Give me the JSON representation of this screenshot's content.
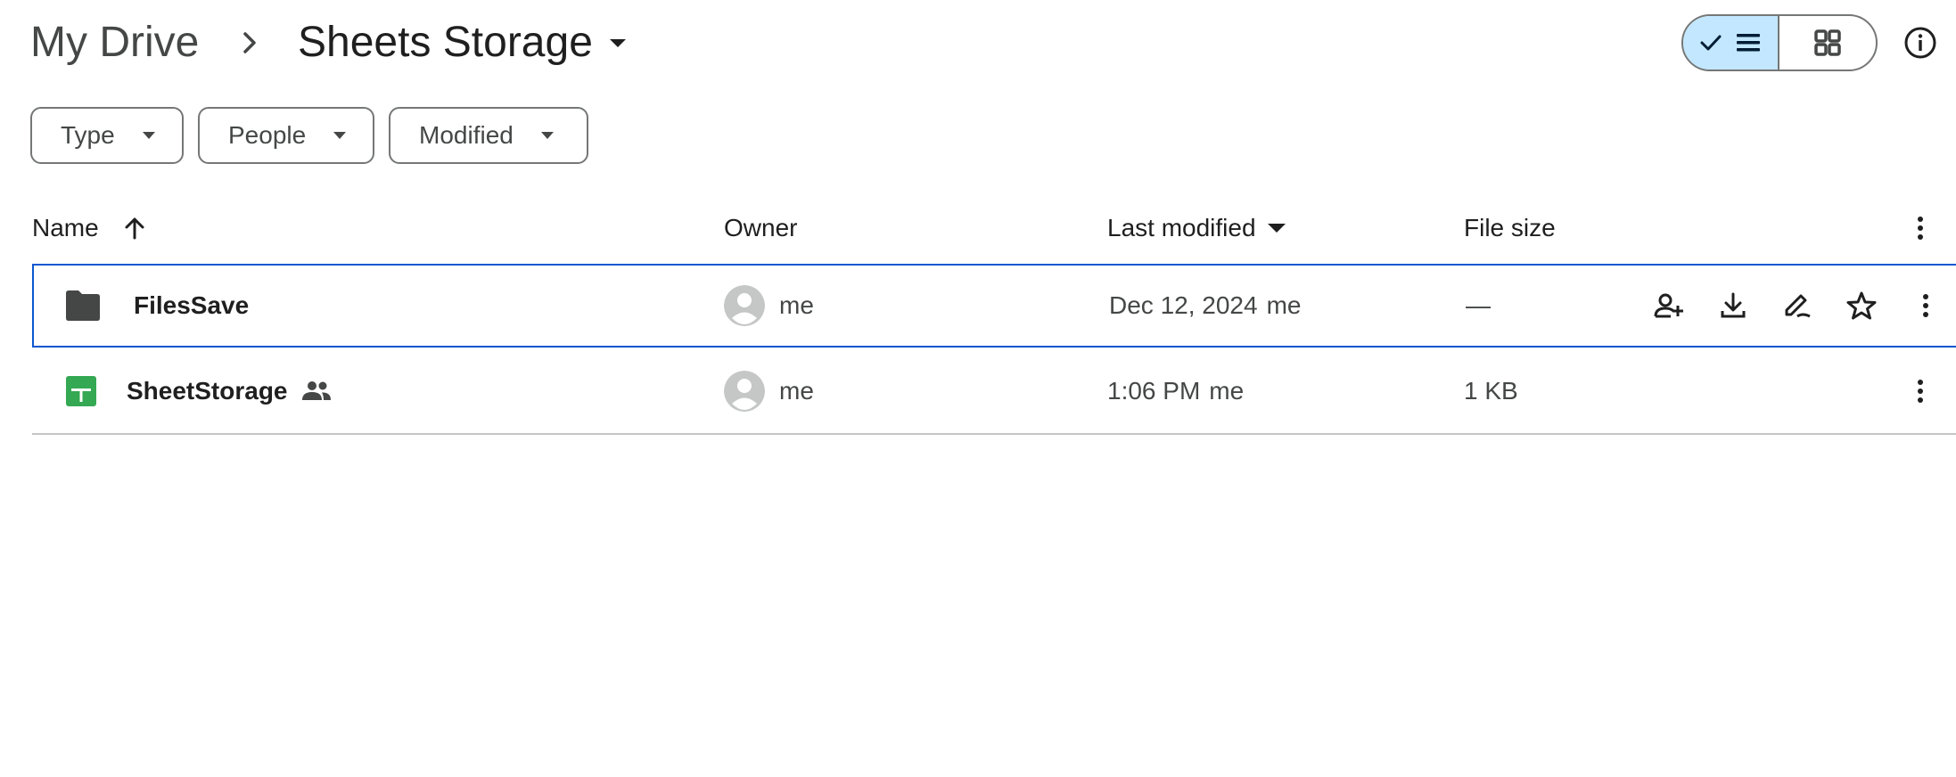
{
  "breadcrumb": {
    "root": "My Drive",
    "current": "Sheets Storage"
  },
  "view": {
    "active": "list",
    "list_icon": "list-icon",
    "grid_icon": "grid-icon",
    "check_icon": "check-icon",
    "info_icon": "info-icon",
    "accent_color": "#c2e7ff"
  },
  "filters": [
    {
      "label": "Type"
    },
    {
      "label": "People"
    },
    {
      "label": "Modified"
    }
  ],
  "columns": {
    "name": "Name",
    "owner": "Owner",
    "last_modified": "Last modified",
    "file_size": "File size"
  },
  "rows": [
    {
      "name": "FilesSave",
      "icon": "folder-icon",
      "shared": false,
      "owner": "me",
      "modified_date": "Dec 12, 2024",
      "modified_by": "me",
      "size": "—",
      "selected": true
    },
    {
      "name": "SheetStorage",
      "icon": "google-sheets-icon",
      "shared": true,
      "owner": "me",
      "modified_date": "1:06 PM",
      "modified_by": "me",
      "size": "1 KB",
      "selected": false
    }
  ],
  "colors": {
    "selection_border": "#0b57d0",
    "sheets_green": "#34a853",
    "folder": "#444746"
  }
}
